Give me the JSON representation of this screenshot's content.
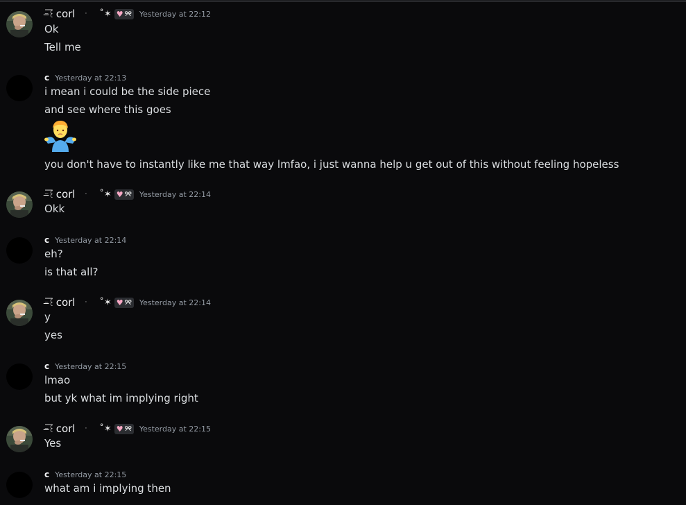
{
  "messages": [
    {
      "author": "corl",
      "author_prefix": "⁻̶͞꒰",
      "author_suffix": "˚✶",
      "tag_heart": "♥",
      "tag_text": "୨୧",
      "timestamp": "Yesterday at 22:12",
      "lines": [
        "Ok",
        "Tell me"
      ]
    },
    {
      "author": "c",
      "timestamp": "Yesterday at 22:13",
      "lines": [
        "i mean i could be the side piece",
        "and see where this goes",
        "you don't have to instantly like me that way lmfao, i just wanna help u get out of this without feeling hopeless"
      ],
      "emoji": "person-shrugging"
    },
    {
      "author": "corl",
      "author_prefix": "⁻̶͞꒰",
      "author_suffix": "˚✶",
      "tag_heart": "♥",
      "tag_text": "୨୧",
      "timestamp": "Yesterday at 22:14",
      "lines": [
        "Okk"
      ]
    },
    {
      "author": "c",
      "timestamp": "Yesterday at 22:14",
      "lines": [
        "eh?",
        "is that all?"
      ]
    },
    {
      "author": "corl",
      "author_prefix": "⁻̶͞꒰",
      "author_suffix": "˚✶",
      "tag_heart": "♥",
      "tag_text": "୨୧",
      "timestamp": "Yesterday at 22:14",
      "lines": [
        "y",
        "yes"
      ]
    },
    {
      "author": "c",
      "timestamp": "Yesterday at 22:15",
      "lines": [
        "lmao",
        "but yk what im implying right"
      ]
    },
    {
      "author": "corl",
      "author_prefix": "⁻̶͞꒰",
      "author_suffix": "˚✶",
      "tag_heart": "♥",
      "tag_text": "୨୧",
      "timestamp": "Yesterday at 22:15",
      "lines": [
        "Yes"
      ]
    },
    {
      "author": "c",
      "timestamp": "Yesterday at 22:15",
      "lines": [
        "what am i implying then"
      ]
    }
  ]
}
